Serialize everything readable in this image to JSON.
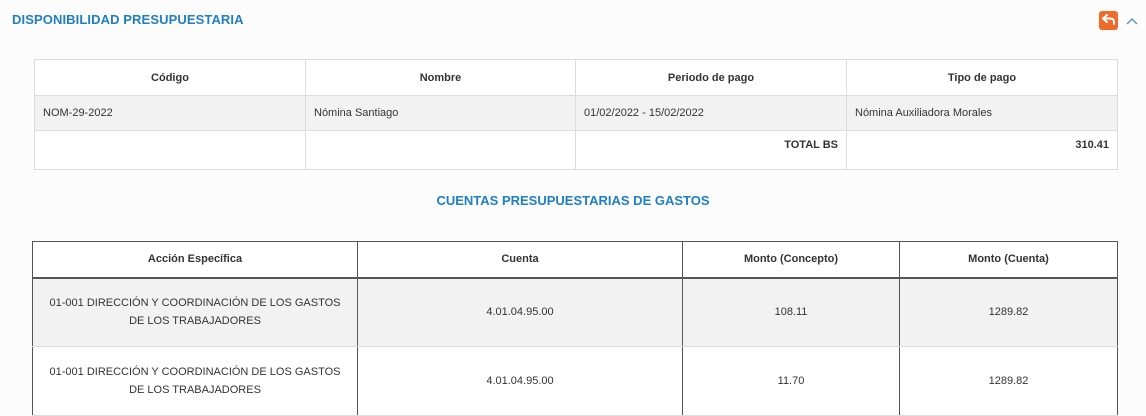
{
  "panel": {
    "title": "DISPONIBILIDAD PRESUPUESTARIA",
    "back_icon": "undo-arrow-icon",
    "collapse_icon": "chevron-up-icon",
    "accent_color": "#1f7fc1",
    "back_button_color": "#f06a2c"
  },
  "nomina_table": {
    "headers": [
      "Código",
      "Nombre",
      "Periodo de pago",
      "Tipo de pago"
    ],
    "row": {
      "codigo": "NOM-29-2022",
      "nombre": "Nómina Santiago",
      "periodo": "01/02/2022 - 15/02/2022",
      "tipo": "Nómina Auxiliadora Morales"
    },
    "total_label": "TOTAL BS",
    "total_value": "310.41"
  },
  "gastos": {
    "title": "CUENTAS PRESUPUESTARIAS DE GASTOS",
    "headers": [
      "Acción Específica",
      "Cuenta",
      "Monto (Concepto)",
      "Monto (Cuenta)"
    ],
    "rows": [
      {
        "accion": "01-001 DIRECCIÓN Y COORDINACIÓN DE LOS GASTOS DE LOS TRABAJADORES",
        "cuenta": "4.01.04.95.00",
        "monto_concepto": "108.11",
        "monto_cuenta": "1289.82"
      },
      {
        "accion": "01-001 DIRECCIÓN Y COORDINACIÓN DE LOS GASTOS DE LOS TRABAJADORES",
        "cuenta": "4.01.04.95.00",
        "monto_concepto": "11.70",
        "monto_cuenta": "1289.82"
      }
    ]
  }
}
